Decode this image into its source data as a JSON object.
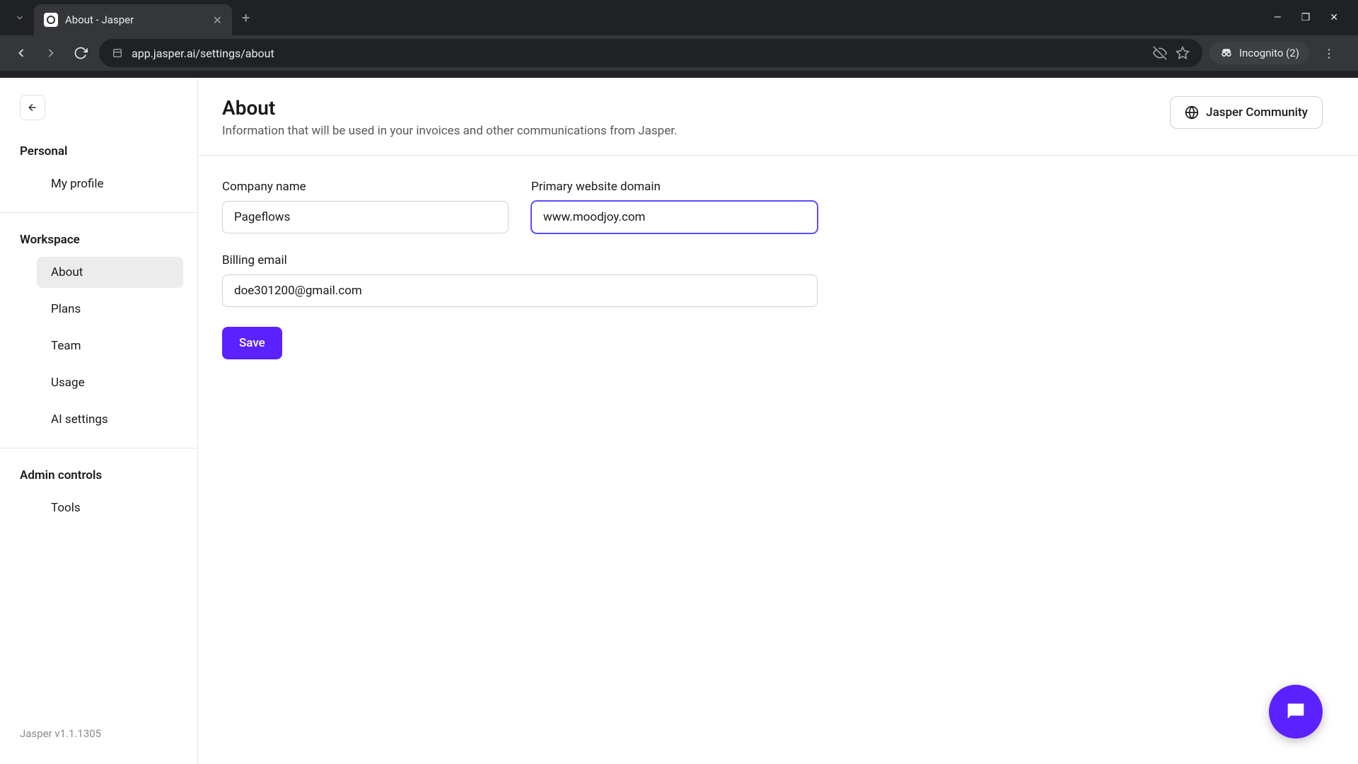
{
  "browser": {
    "tab_title": "About - Jasper",
    "url_display": "app.jasper.ai/settings/about",
    "incognito_label": "Incognito (2)"
  },
  "sidebar": {
    "sections": {
      "personal": {
        "label": "Personal",
        "items": [
          {
            "label": "My profile"
          }
        ]
      },
      "workspace": {
        "label": "Workspace",
        "items": [
          {
            "label": "About"
          },
          {
            "label": "Plans"
          },
          {
            "label": "Team"
          },
          {
            "label": "Usage"
          },
          {
            "label": "AI settings"
          }
        ]
      },
      "admin": {
        "label": "Admin controls",
        "items": [
          {
            "label": "Tools"
          }
        ]
      }
    },
    "version": "Jasper v1.1.1305"
  },
  "header": {
    "title": "About",
    "subtitle": "Information that will be used in your invoices and other communications from Jasper.",
    "community_button": "Jasper Community"
  },
  "form": {
    "company_name": {
      "label": "Company name",
      "value": "Pageflows"
    },
    "website": {
      "label": "Primary website domain",
      "value": "www.moodjoy.com"
    },
    "billing_email": {
      "label": "Billing email",
      "value": "doe301200@gmail.com"
    },
    "save_label": "Save"
  }
}
